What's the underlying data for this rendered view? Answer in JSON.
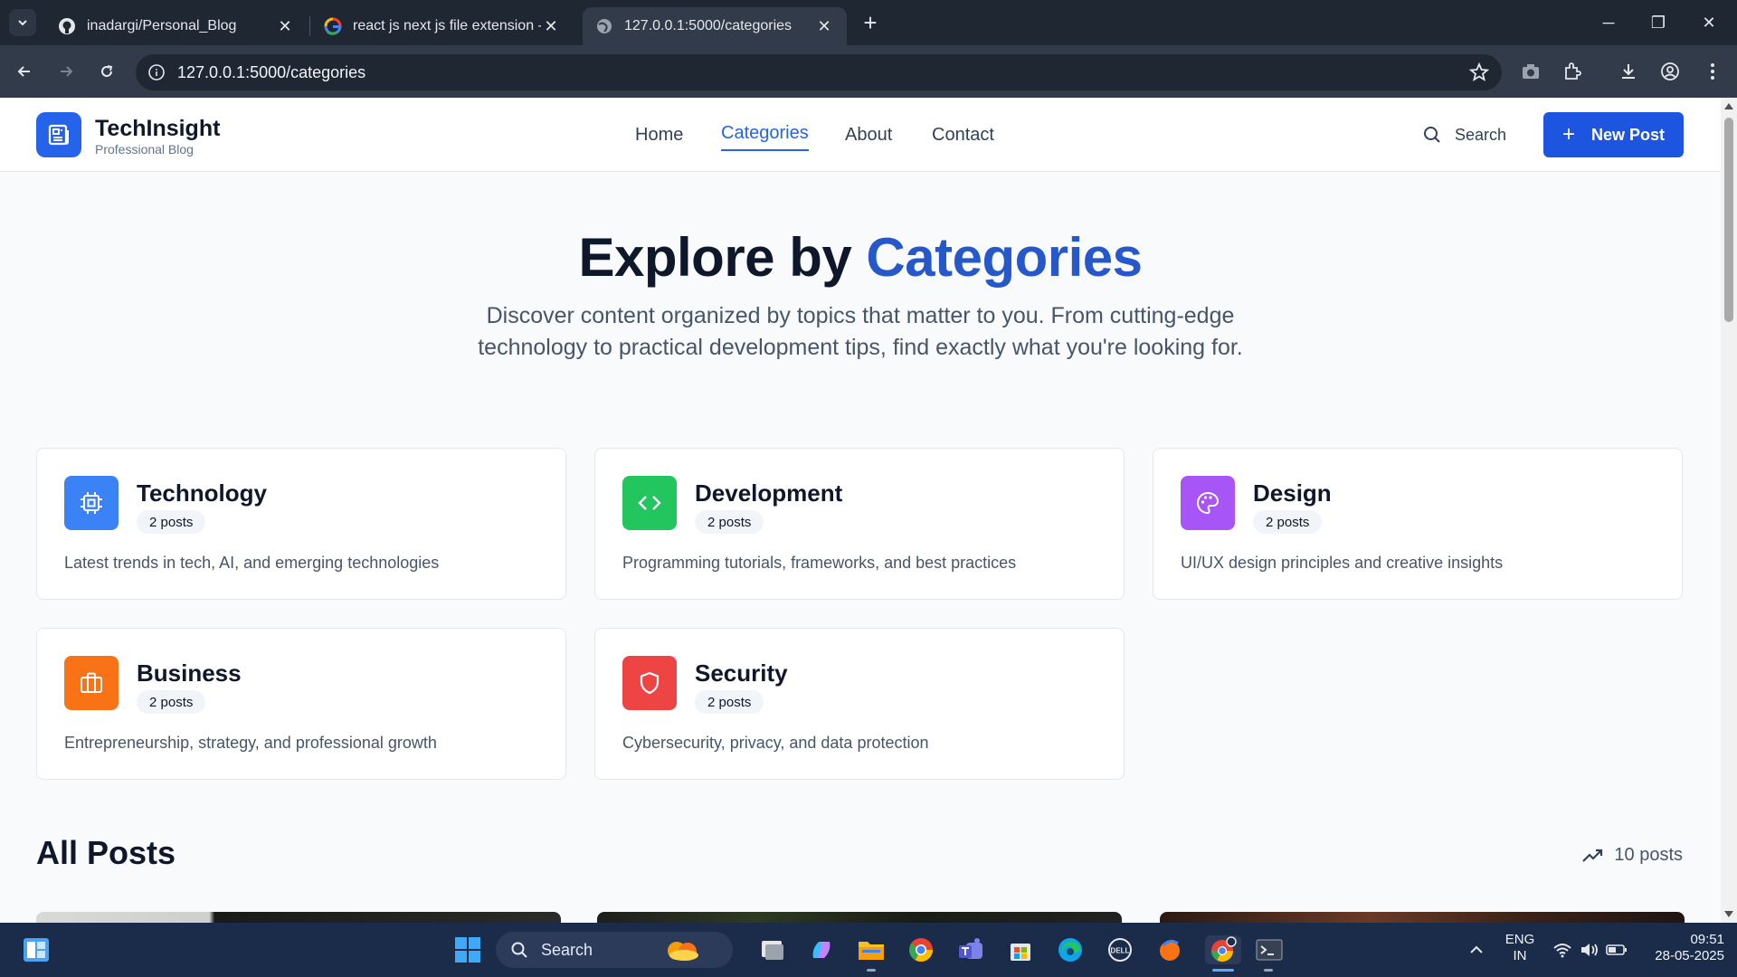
{
  "browser": {
    "tabs": [
      {
        "title": "inadargi/Personal_Blog",
        "icon": "github-icon",
        "active": false
      },
      {
        "title": "react js next js file extension - G",
        "icon": "google-icon",
        "active": false
      },
      {
        "title": "127.0.0.1:5000/categories",
        "icon": "globe-icon",
        "active": true
      }
    ],
    "url": "127.0.0.1:5000/categories"
  },
  "site": {
    "brand": "TechInsight",
    "brand_sub": "Professional Blog",
    "nav": [
      "Home",
      "Categories",
      "About",
      "Contact"
    ],
    "active_nav": "Categories",
    "search_label": "Search",
    "new_post_label": "New Post",
    "accent_color": "#2563eb"
  },
  "hero": {
    "title_prefix": "Explore by ",
    "title_accent": "Categories",
    "description": "Discover content organized by topics that matter to you. From cutting-edge technology to practical development tips, find exactly what you're looking for."
  },
  "categories": [
    {
      "name": "Technology",
      "posts": "2 posts",
      "description": "Latest trends in tech, AI, and emerging technologies",
      "color": "#3b82f6",
      "icon": "cpu-icon"
    },
    {
      "name": "Development",
      "posts": "2 posts",
      "description": "Programming tutorials, frameworks, and best practices",
      "color": "#22c55e",
      "icon": "code-icon"
    },
    {
      "name": "Design",
      "posts": "2 posts",
      "description": "UI/UX design principles and creative insights",
      "color": "#a855f7",
      "icon": "palette-icon"
    },
    {
      "name": "Business",
      "posts": "2 posts",
      "description": "Entrepreneurship, strategy, and professional growth",
      "color": "#f97316",
      "icon": "briefcase-icon"
    },
    {
      "name": "Security",
      "posts": "2 posts",
      "description": "Cybersecurity, privacy, and data protection",
      "color": "#ef4444",
      "icon": "shield-icon"
    }
  ],
  "all_posts": {
    "title": "All Posts",
    "count": "10 posts"
  },
  "taskbar": {
    "search_label": "Search",
    "language": "ENG",
    "region": "IN",
    "time": "09:51",
    "date": "28-05-2025"
  }
}
